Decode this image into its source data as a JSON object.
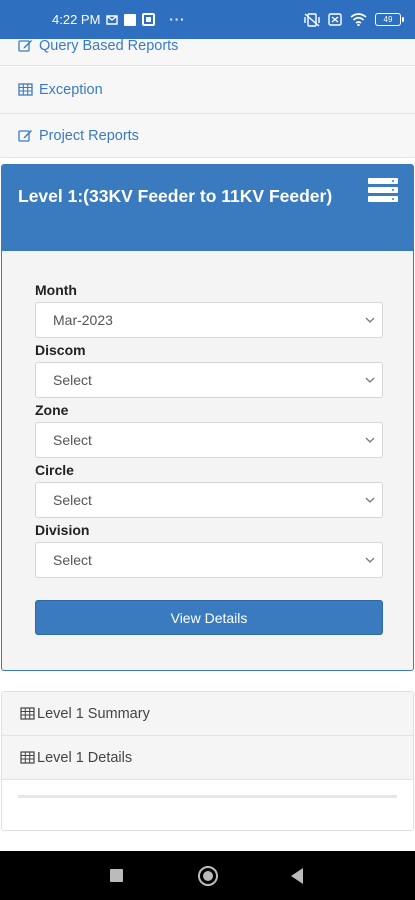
{
  "status_bar": {
    "time": "4:22 PM",
    "battery": "49"
  },
  "menu": {
    "items": [
      {
        "label": "Query Based Reports",
        "icon": "edit-icon"
      },
      {
        "label": "Exception",
        "icon": "table-icon"
      },
      {
        "label": "Project Reports",
        "icon": "edit-icon"
      }
    ]
  },
  "panel": {
    "title": "Level 1:(33KV Feeder to 11KV Feeder)",
    "fields": [
      {
        "label": "Month",
        "value": "Mar-2023"
      },
      {
        "label": "Discom",
        "value": "Select"
      },
      {
        "label": "Zone",
        "value": "Select"
      },
      {
        "label": "Circle",
        "value": "Select"
      },
      {
        "label": "Division",
        "value": "Select"
      }
    ],
    "button_label": "View Details"
  },
  "lower_list": {
    "items": [
      {
        "label": "Level 1 Summary",
        "icon": "table-icon"
      },
      {
        "label": "Level 1 Details",
        "icon": "table-icon"
      }
    ]
  },
  "colors": {
    "accent": "#3a7bc0",
    "status_bar": "#2f6fc0"
  }
}
